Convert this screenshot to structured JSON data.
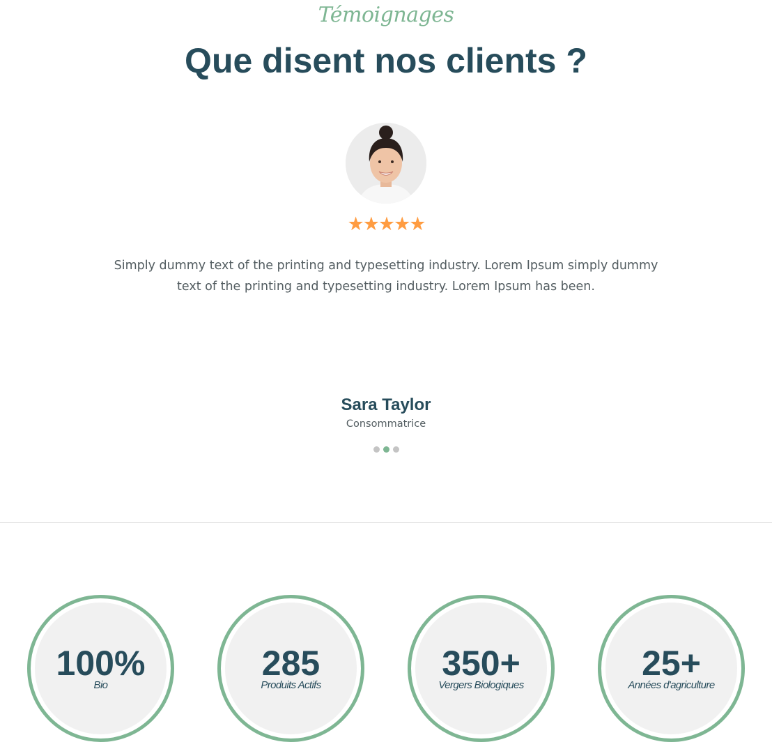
{
  "testimonials": {
    "eyebrow": "Témoignages",
    "title": "Que disent nos clients ?",
    "rating": "★★★★★",
    "quote": "Simply dummy text of the printing and typesetting industry. Lorem Ipsum simply dummy text of the printing and typesetting industry. Lorem Ipsum has been.",
    "author_name": "Sara Taylor",
    "author_role": "Consommatrice",
    "slide_count": 3,
    "active_slide": 2
  },
  "stats": [
    {
      "value": "100%",
      "label": "Bio"
    },
    {
      "value": "285",
      "label": "Produits Actifs"
    },
    {
      "value": "350+",
      "label": "Vergers Biologiques"
    },
    {
      "value": "25+",
      "label": "Années d'agriculture"
    }
  ],
  "colors": {
    "accent": "#7eb693",
    "heading": "#274c5b",
    "star": "#ff9c41",
    "body_text": "#525c60"
  },
  "icons": {
    "rating": "star-icon",
    "avatar": "user-photo"
  }
}
